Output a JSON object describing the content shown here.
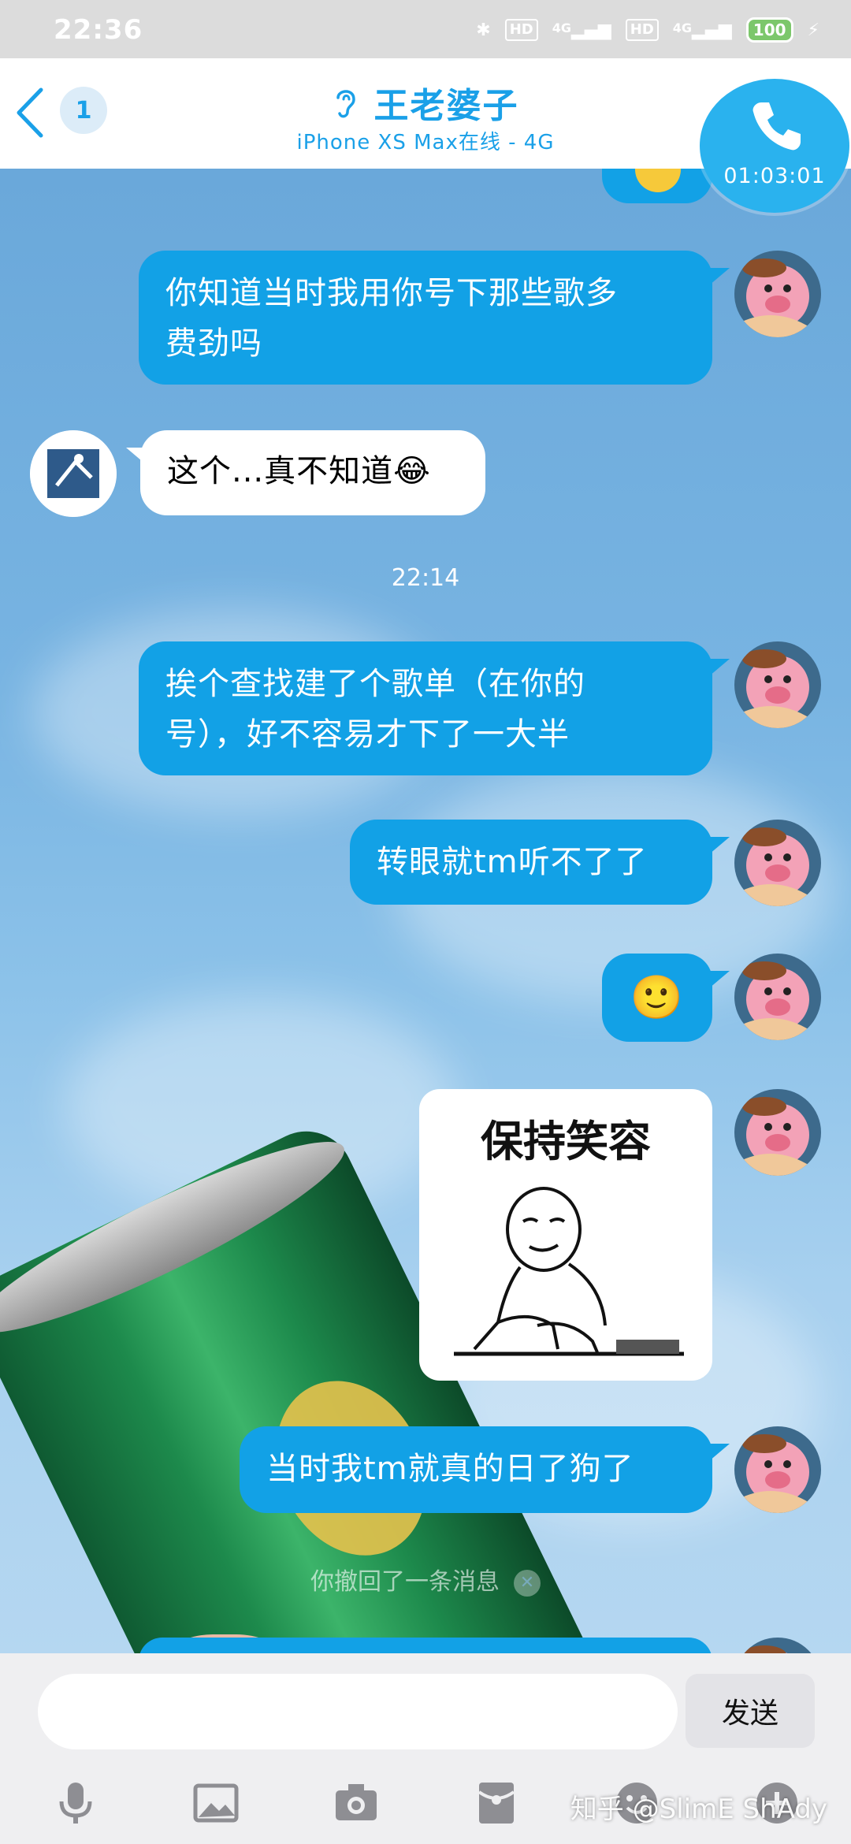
{
  "status_bar": {
    "time": "22:36",
    "network_left": "4G",
    "network_right": "4G",
    "hd": "HD",
    "battery": "100"
  },
  "header": {
    "unread_count": "1",
    "contact_name": "王老婆子",
    "contact_status": "iPhone XS Max在线 - 4G",
    "call_timer": "01:03:01"
  },
  "messages": [
    {
      "from": "me",
      "text": "你知道当时我用你号下那些歌多费劲吗"
    },
    {
      "from": "them",
      "text": "这个...真不知道😂"
    },
    {
      "type": "time",
      "text": "22:14"
    },
    {
      "from": "me",
      "text": "挨个查找建了个歌单（在你的号），好不容易才下了一大半"
    },
    {
      "from": "me",
      "text": "转眼就tm听不了了"
    },
    {
      "from": "me",
      "text": "🙂"
    },
    {
      "from": "me",
      "type": "sticker",
      "text": "保持笑容"
    },
    {
      "from": "me",
      "text": "当时我tm就真的日了狗了"
    }
  ],
  "msg_text": {
    "m1_line1": "你知道当时我用你号下那些歌多",
    "m1_line2": "费劲吗",
    "m2": "这个...真不知道😂",
    "time1": "22:14",
    "m3_line1": "挨个查找建了个歌单（在你的",
    "m3_line2": "号），好不容易才下了一大半",
    "m4": "转眼就tm听不了了",
    "m5": "🙂",
    "sticker_caption": "保持笑容",
    "m6": "当时我tm就真的日了狗了"
  },
  "recall_note": "你撤回了一条消息",
  "input": {
    "placeholder": "",
    "value": "",
    "send_label": "发送"
  },
  "toolbar_icons": [
    "microphone-icon",
    "image-icon",
    "camera-icon",
    "red-packet-icon",
    "emoji-icon",
    "plus-icon"
  ],
  "watermark": "知乎 @SlimE ShAdy",
  "colors": {
    "accent": "#1aa0e8",
    "bubble_out": "#12a1e6",
    "bubble_in": "#ffffff",
    "input_bg": "#efeff1"
  }
}
